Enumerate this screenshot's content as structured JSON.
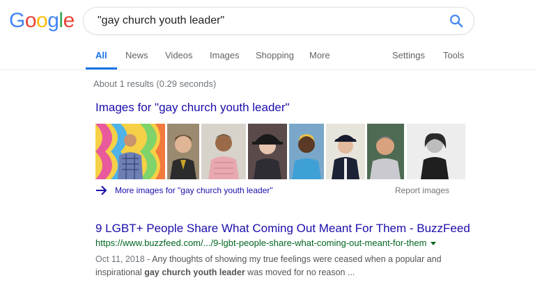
{
  "logo": {
    "letters": [
      {
        "char": "G",
        "color": "#4285F4"
      },
      {
        "char": "o",
        "color": "#EA4335"
      },
      {
        "char": "o",
        "color": "#FBBC05"
      },
      {
        "char": "g",
        "color": "#4285F4"
      },
      {
        "char": "l",
        "color": "#34A853"
      },
      {
        "char": "e",
        "color": "#EA4335"
      }
    ]
  },
  "search": {
    "query": "\"gay church youth leader\"",
    "icon": "search-icon"
  },
  "tabs": {
    "all": "All",
    "news": "News",
    "videos": "Videos",
    "images": "Images",
    "shopping": "Shopping",
    "more": "More",
    "settings": "Settings",
    "tools": "Tools"
  },
  "stats": "About 1 results (0.29 seconds)",
  "images_section": {
    "heading": "Images for \"gay church youth leader\"",
    "more_link": "More images for \"gay church youth leader\"",
    "report": "Report images",
    "arrow_icon": "arrow-right-icon",
    "thumb_count": 8
  },
  "result": {
    "title": "9 LGBT+ People Share What Coming Out Meant For Them - BuzzFeed",
    "url": "https://www.buzzfeed.com/.../9-lgbt-people-share-what-coming-out-meant-for-them",
    "date": "Oct 11, 2018",
    "snippet_pre": " - Any thoughts of showing my true feelings were ceased when a popular and inspirational",
    "snippet_bold": "gay church youth leader",
    "snippet_post": " was moved for no reason ..."
  },
  "colors": {
    "link": "#1a0dab",
    "url": "#006621",
    "accent": "#1a73e8",
    "muted": "#70757a"
  }
}
